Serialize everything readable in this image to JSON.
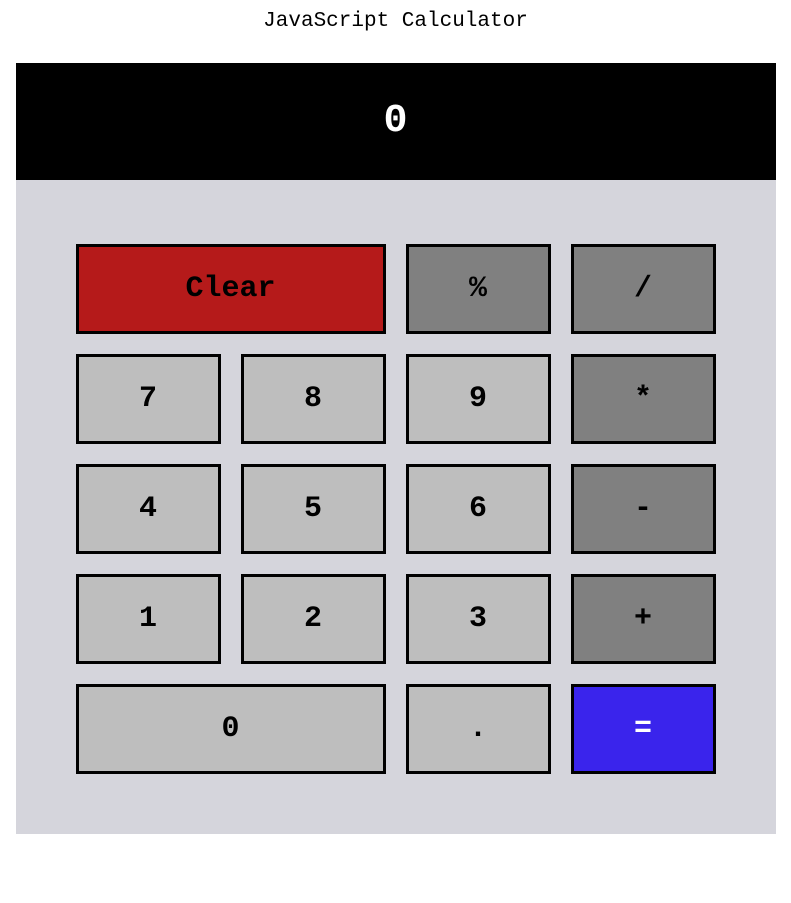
{
  "page": {
    "title": "JavaScript Calculator"
  },
  "display": {
    "value": "0"
  },
  "buttons": {
    "clear": "Clear",
    "percent": "%",
    "divide": "/",
    "seven": "7",
    "eight": "8",
    "nine": "9",
    "multiply": "*",
    "four": "4",
    "five": "5",
    "six": "6",
    "subtract": "-",
    "one": "1",
    "two": "2",
    "three": "3",
    "add": "+",
    "zero": "0",
    "decimal": ".",
    "equals": "="
  }
}
